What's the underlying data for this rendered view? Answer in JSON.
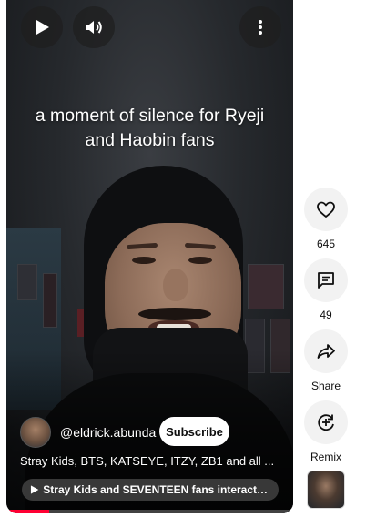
{
  "video": {
    "caption_line1": "a moment of silence for Ryeji",
    "caption_line2": "and Haobin fans",
    "progress_fraction": 0.15
  },
  "controls": {
    "play_icon": "play-icon",
    "volume_icon": "volume-icon",
    "more_icon": "more-vert-icon"
  },
  "channel": {
    "handle": "@eldrick.abunda",
    "subscribe_label": "Subscribe"
  },
  "description": "Stray Kids, BTS, KATSEYE, ITZY, ZB1 and all ...",
  "related_pill": {
    "icon": "play-icon",
    "label": "Stray Kids and SEVENTEEN fans interacting ..."
  },
  "actions": {
    "like": {
      "icon": "thumb-up-icon",
      "label": "645"
    },
    "comment": {
      "icon": "comment-icon",
      "label": "49"
    },
    "share": {
      "icon": "share-icon",
      "label": "Share"
    },
    "remix": {
      "icon": "remix-icon",
      "label": "Remix"
    }
  },
  "colors": {
    "progress": "#ff0033",
    "action_button_bg": "#f2f2f2",
    "subscribe_bg": "#ffffff"
  }
}
